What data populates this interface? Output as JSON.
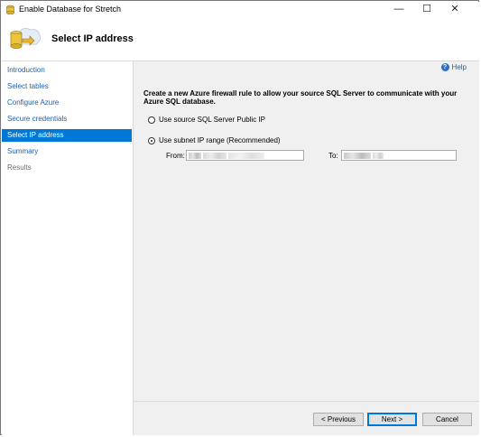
{
  "window": {
    "title": "Enable Database for Stretch",
    "minimize_glyph": "—",
    "maximize_glyph": "☐",
    "close_glyph": "✕"
  },
  "header": {
    "title": "Select IP address",
    "icon": "database-stretch-icon"
  },
  "nav": {
    "items": [
      {
        "label": "Introduction",
        "state": "link"
      },
      {
        "label": "Select tables",
        "state": "link"
      },
      {
        "label": "Configure Azure",
        "state": "link"
      },
      {
        "label": "Secure credentials",
        "state": "link"
      },
      {
        "label": "Select IP address",
        "state": "active"
      },
      {
        "label": "Summary",
        "state": "link"
      },
      {
        "label": "Results",
        "state": "disabled"
      }
    ]
  },
  "content": {
    "help_label": "Help",
    "description": "Create a new Azure firewall rule to allow your source SQL Server to communicate with your Azure SQL database.",
    "option_public_ip": "Use source SQL Server Public IP",
    "option_subnet": "Use subnet IP range (Recommended)",
    "selected_option": "subnet",
    "from_label": "From:",
    "to_label": "To:"
  },
  "footer": {
    "previous_label": "< Previous",
    "next_label": "Next >",
    "cancel_label": "Cancel"
  },
  "colors": {
    "accent": "#0078d7",
    "link": "#1a5fb4",
    "content_bg": "#f0f0f0"
  }
}
